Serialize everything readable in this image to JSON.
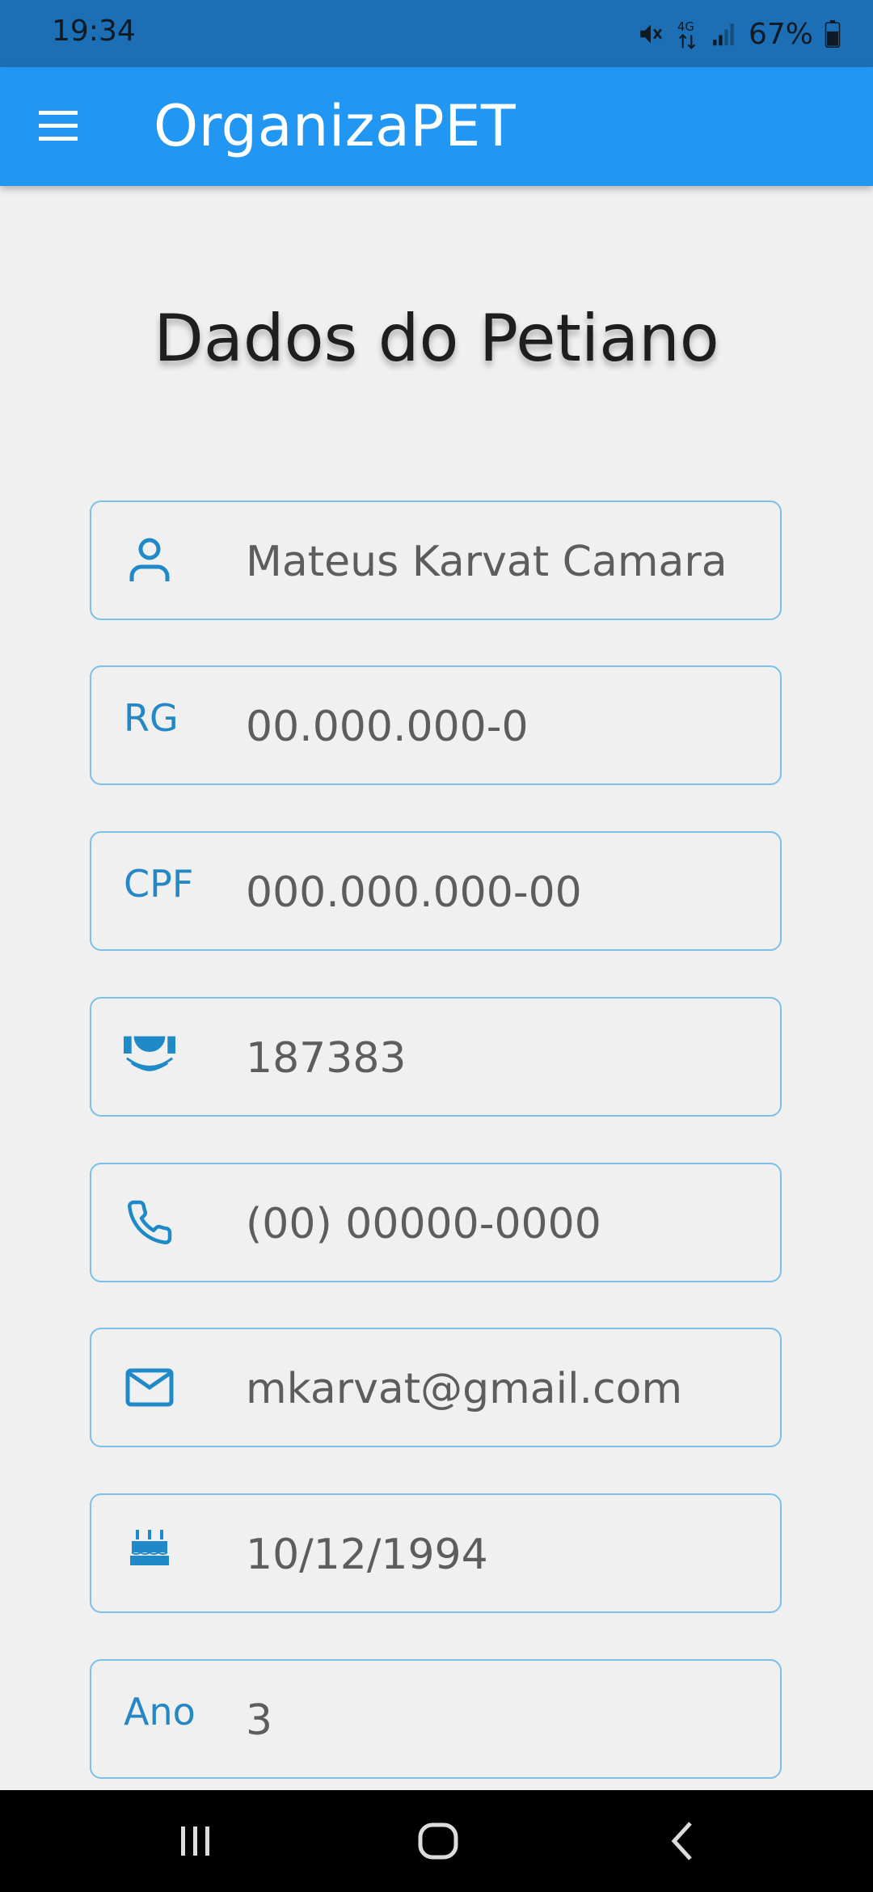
{
  "status_bar": {
    "time": "19:34",
    "battery": "67%",
    "network": "4G",
    "icons": [
      "mute-icon",
      "network-4g-icon",
      "signal-icon",
      "battery-icon"
    ]
  },
  "app_bar": {
    "title": "OrganizaPET",
    "menu_icon": "menu-icon"
  },
  "page": {
    "title": "Dados do Petiano"
  },
  "fields": {
    "name": {
      "icon": "person-icon",
      "value": "Mateus Karvat Camara"
    },
    "rg": {
      "prefix": "RG",
      "value": "00.000.000-0"
    },
    "cpf": {
      "prefix": "CPF",
      "value": "000.000.000-00"
    },
    "registration": {
      "icon": "university-logo-icon",
      "value": "187383"
    },
    "phone": {
      "icon": "phone-icon",
      "value": "(00) 00000-0000"
    },
    "email": {
      "icon": "email-icon",
      "value": "mkarvat@gmail.com"
    },
    "birthday": {
      "icon": "cake-icon",
      "value": "10/12/1994"
    },
    "year": {
      "prefix": "Ano",
      "value": "3"
    }
  },
  "nav_bar": {
    "icons": [
      "recents-icon",
      "home-icon",
      "back-icon"
    ]
  },
  "colors": {
    "status_bar": "#1c6fb5",
    "app_bar": "#2196f3",
    "field_border": "#7cc0e8",
    "accent_icon": "#1f8ac7",
    "background": "#f0f0f0"
  }
}
